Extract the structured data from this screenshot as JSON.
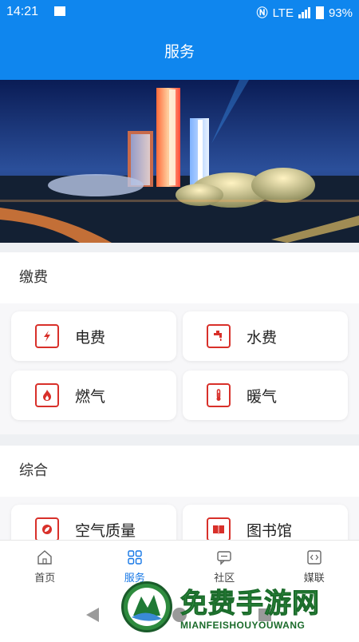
{
  "status_bar": {
    "time": "14:21",
    "network": "LTE",
    "battery": "93%"
  },
  "app_bar": {
    "title": "服务"
  },
  "sections": [
    {
      "title": "缴费",
      "items": [
        {
          "label": "电费",
          "icon": "lightning-icon"
        },
        {
          "label": "水费",
          "icon": "faucet-icon"
        },
        {
          "label": "燃气",
          "icon": "flame-icon"
        },
        {
          "label": "暖气",
          "icon": "thermometer-icon"
        }
      ]
    },
    {
      "title": "综合",
      "items": [
        {
          "label": "空气质量",
          "icon": "leaf-icon"
        },
        {
          "label": "图书馆",
          "icon": "book-icon"
        }
      ]
    }
  ],
  "bottom_nav": [
    {
      "label": "首页",
      "icon": "home-icon",
      "active": false
    },
    {
      "label": "服务",
      "icon": "grid-icon",
      "active": true
    },
    {
      "label": "社区",
      "icon": "chat-icon",
      "active": false
    },
    {
      "label": "媒联",
      "icon": "media-icon",
      "active": false
    }
  ],
  "watermark": {
    "title": "免费手游网",
    "subtitle": "MIANFEISHOUYOUWANG"
  },
  "colors": {
    "primary": "#0f86ee",
    "accent_red": "#d8302a",
    "nav_active": "#1677e6"
  }
}
